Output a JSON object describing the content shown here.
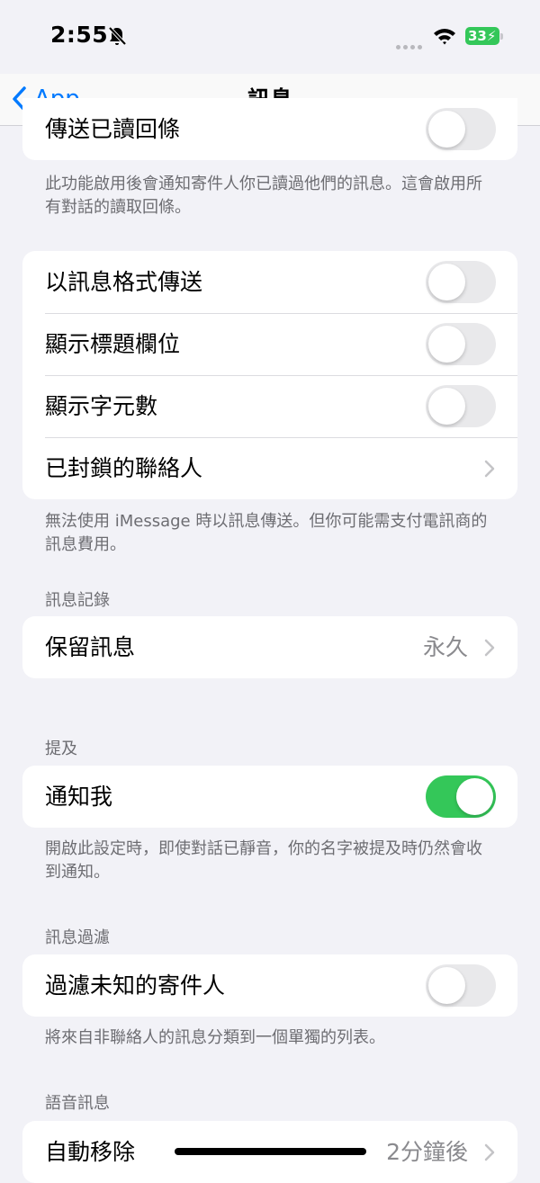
{
  "status": {
    "time": "2:55",
    "battery": "33"
  },
  "nav": {
    "back_label": "App",
    "title": "訊息"
  },
  "read_receipts": {
    "label": "傳送已讀回條",
    "on": false,
    "footnote": "此功能啟用後會通知寄件人你已讀過他們的訊息。這會啟用所有對話的讀取回條。"
  },
  "sms_group": {
    "rows": [
      {
        "label": "以訊息格式傳送",
        "on": false
      },
      {
        "label": "顯示標題欄位",
        "on": false
      },
      {
        "label": "顯示字元數",
        "on": false
      },
      {
        "label": "已封鎖的聯絡人"
      }
    ],
    "footnote": "無法使用 iMessage 時以訊息傳送。但你可能需支付電訊商的訊息費用。"
  },
  "history": {
    "header": "訊息記錄",
    "keep_label": "保留訊息",
    "keep_value": "永久"
  },
  "mentions": {
    "header": "提及",
    "notify_label": "通知我",
    "notify_on": true,
    "footnote": "開啟此設定時，即使對話已靜音，你的名字被提及時仍然會收到通知。"
  },
  "filtering": {
    "header": "訊息過濾",
    "filter_label": "過濾未知的寄件人",
    "filter_on": false,
    "footnote": "將來自非聯絡人的訊息分類到一個單獨的列表。"
  },
  "audio": {
    "header": "語音訊息",
    "expire_label": "自動移除",
    "expire_value": "2分鐘後"
  },
  "colors": {
    "accent": "#007aff",
    "toggle_on": "#34c759",
    "background": "#f2f2f7"
  }
}
